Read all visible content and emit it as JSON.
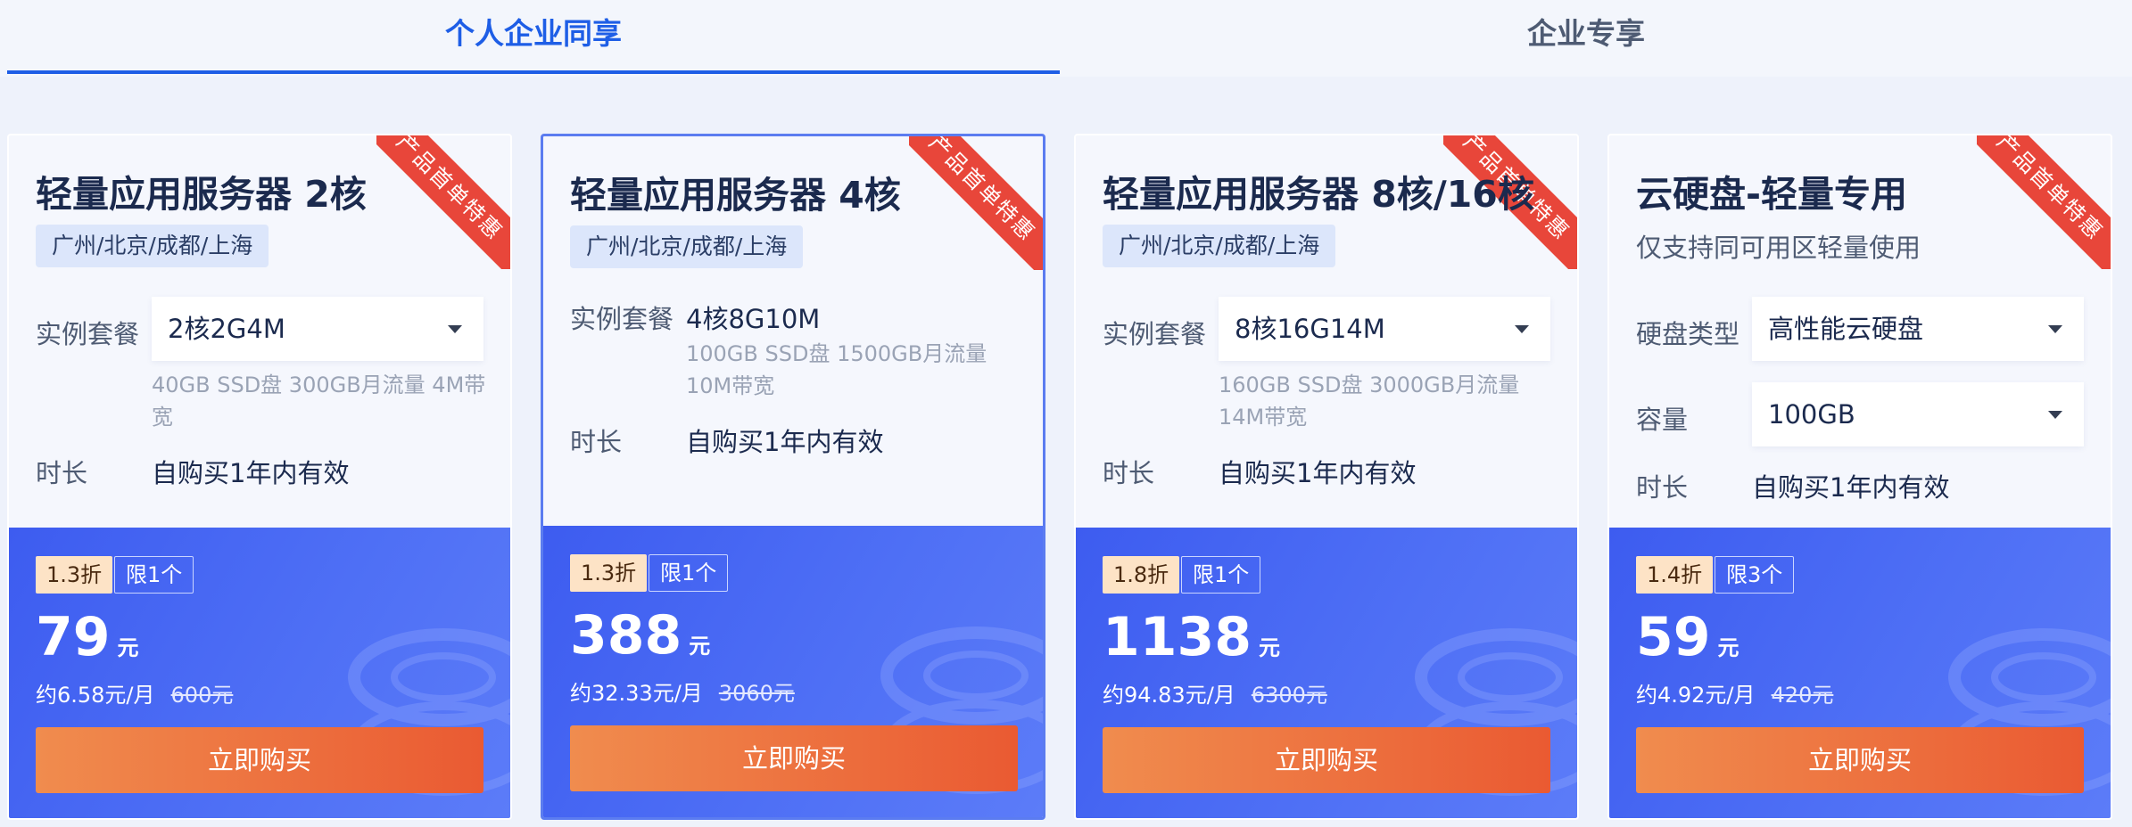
{
  "tabs": [
    {
      "label": "个人企业同享",
      "active": true
    },
    {
      "label": "企业专享",
      "active": false
    }
  ],
  "ribbon_text": "产品首单特惠",
  "colors": {
    "accent": "#1e5ee6",
    "ribbon": "#e8463a",
    "buy_button": "#ea5a32",
    "price_area": "#4e6ff5"
  },
  "cards": [
    {
      "title": "轻量应用服务器 2核",
      "region": "广州/北京/成都/上海",
      "package_label": "实例套餐",
      "package_value": "2核2G4M",
      "package_desc": "40GB SSD盘 300GB月流量 4M带宽",
      "duration_label": "时长",
      "duration_value": "自购买1年内有效",
      "discount": "1.3折",
      "limit": "限1个",
      "price": "79",
      "price_unit": "元",
      "monthly": "约6.58元/月",
      "original_price": "600元",
      "buy_label": "立即购买"
    },
    {
      "title": "轻量应用服务器 4核",
      "region": "广州/北京/成都/上海",
      "package_label": "实例套餐",
      "package_value": "4核8G10M",
      "package_desc": "100GB SSD盘 1500GB月流量 10M带宽",
      "duration_label": "时长",
      "duration_value": "自购买1年内有效",
      "discount": "1.3折",
      "limit": "限1个",
      "price": "388",
      "price_unit": "元",
      "monthly": "约32.33元/月",
      "original_price": "3060元",
      "buy_label": "立即购买"
    },
    {
      "title": "轻量应用服务器 8核/16核",
      "region": "广州/北京/成都/上海",
      "package_label": "实例套餐",
      "package_value": "8核16G14M",
      "package_desc": "160GB SSD盘 3000GB月流量 14M带宽",
      "duration_label": "时长",
      "duration_value": "自购买1年内有效",
      "discount": "1.8折",
      "limit": "限1个",
      "price": "1138",
      "price_unit": "元",
      "monthly": "约94.83元/月",
      "original_price": "6300元",
      "buy_label": "立即购买"
    },
    {
      "title": "云硬盘-轻量专用",
      "subtitle": "仅支持同可用区轻量使用",
      "disk_type_label": "硬盘类型",
      "disk_type_value": "高性能云硬盘",
      "capacity_label": "容量",
      "capacity_value": "100GB",
      "duration_label": "时长",
      "duration_value": "自购买1年内有效",
      "discount": "1.4折",
      "limit": "限3个",
      "price": "59",
      "price_unit": "元",
      "monthly": "约4.92元/月",
      "original_price": "420元",
      "buy_label": "立即购买"
    }
  ]
}
